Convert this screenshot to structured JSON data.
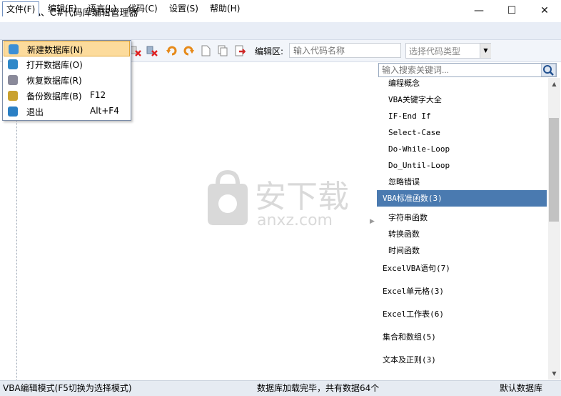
{
  "window": {
    "title": "VBA、C#代码库编辑管理器",
    "minimize": "—",
    "maximize": "☐",
    "close": "✕"
  },
  "menubar": [
    {
      "label": "文件(F)"
    },
    {
      "label": "编辑(E)"
    },
    {
      "label": "语言(L)"
    },
    {
      "label": "代码(C)"
    },
    {
      "label": "设置(S)"
    },
    {
      "label": "帮助(H)"
    }
  ],
  "file_menu": [
    {
      "label": "新建数据库(N)",
      "shortcut": "",
      "icon": "new-db-icon",
      "color": "#3b8fd6"
    },
    {
      "label": "打开数据库(O)",
      "shortcut": "",
      "icon": "open-db-icon",
      "color": "#2f88c9"
    },
    {
      "label": "恢复数据库(R)",
      "shortcut": "",
      "icon": "restore-db-icon",
      "color": "#8a8a9a"
    },
    {
      "label": "备份数据库(B)",
      "shortcut": "F12",
      "icon": "backup-db-icon",
      "color": "#c9a12f"
    },
    {
      "label": "退出",
      "shortcut": "Alt+F4",
      "icon": "exit-icon",
      "color": "#2a7fc4"
    }
  ],
  "toolbar": {
    "edit_label": "编辑区:",
    "name_placeholder": "输入代码名称",
    "type_select": "选择代码类型"
  },
  "search": {
    "placeholder": "输入搜索关键词..."
  },
  "tree": [
    {
      "label": "编程概念",
      "level": "child"
    },
    {
      "label": "VBA关键字大全",
      "level": "child"
    },
    {
      "label": "IF-End If",
      "level": "child"
    },
    {
      "label": "Select-Case",
      "level": "child"
    },
    {
      "label": "Do-While-Loop",
      "level": "child"
    },
    {
      "label": "Do_Until-Loop",
      "level": "child"
    },
    {
      "label": "忽略错误",
      "level": "child"
    },
    {
      "label": "VBA标准函数(3)",
      "level": "parent",
      "selected": true
    },
    {
      "label": "字符串函数",
      "level": "child"
    },
    {
      "label": "转换函数",
      "level": "child"
    },
    {
      "label": "时间函数",
      "level": "child"
    },
    {
      "label": "ExcelVBA语句(7)",
      "level": "parent"
    },
    {
      "label": "Excel单元格(3)",
      "level": "parent"
    },
    {
      "label": "Excel工作表(6)",
      "level": "parent"
    },
    {
      "label": "集合和数组(5)",
      "level": "parent"
    },
    {
      "label": "文本及正则(3)",
      "level": "parent"
    }
  ],
  "status": {
    "mode": "VBA编辑模式(F5切换为选择模式)",
    "load": "数据库加载完毕，共有数据64个",
    "db": "默认数据库"
  },
  "watermark": {
    "brand": "安下载",
    "domain": "anxz.com"
  },
  "colors": {
    "selection": "#4a7ab0",
    "menu_highlight": "#fcdb9c",
    "menubar": "#e8edf6"
  }
}
